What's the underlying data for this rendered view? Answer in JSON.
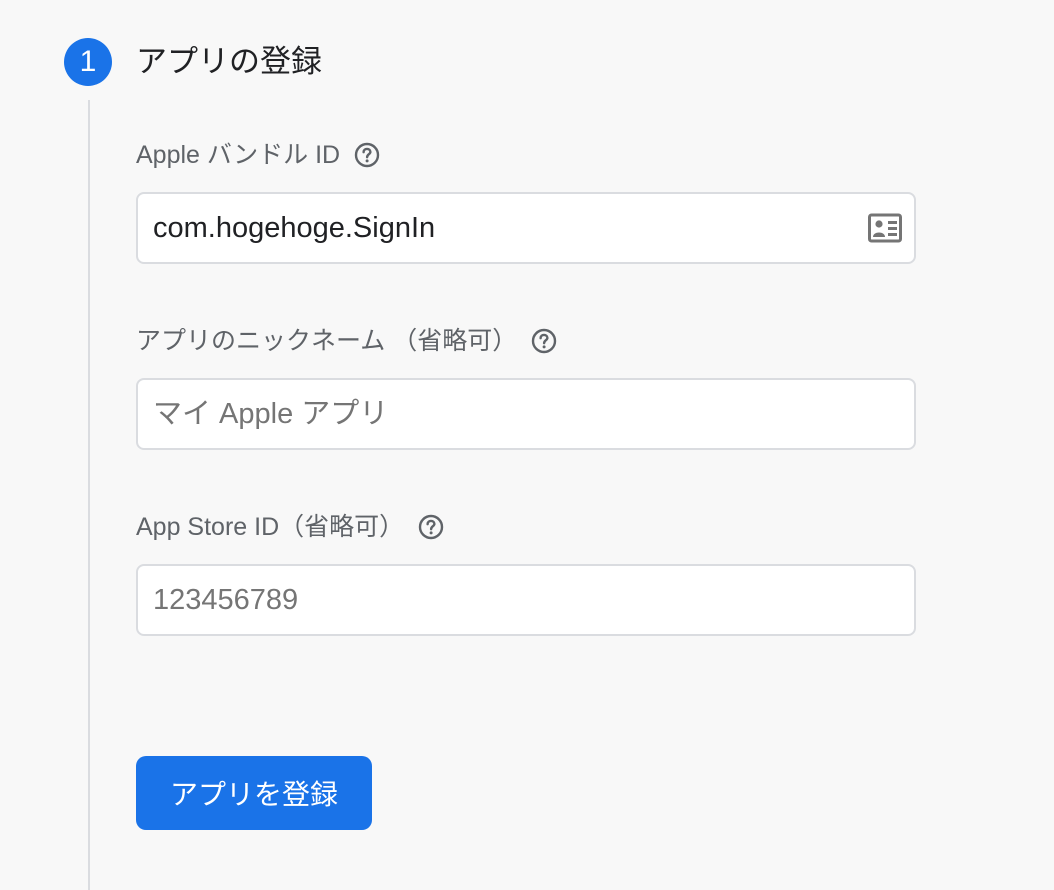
{
  "step": {
    "number": "1",
    "title": "アプリの登録"
  },
  "fields": {
    "bundle_id": {
      "label": "Apple バンドル ID",
      "value": "com.hogehoge.SignIn",
      "help_icon": "question-circle-icon",
      "trailing_icon": "contact-card-icon"
    },
    "nickname": {
      "label": "アプリのニックネーム （省略可）",
      "placeholder": "マイ Apple アプリ",
      "help_icon": "question-circle-icon"
    },
    "app_store_id": {
      "label": "App Store ID（省略可）",
      "placeholder": "123456789",
      "help_icon": "question-circle-icon"
    }
  },
  "register_button": {
    "label": "アプリを登録"
  },
  "colors": {
    "accent": "#1a73e8",
    "background": "#f8f8f8",
    "label": "#5f6368",
    "border": "#dadce0"
  }
}
